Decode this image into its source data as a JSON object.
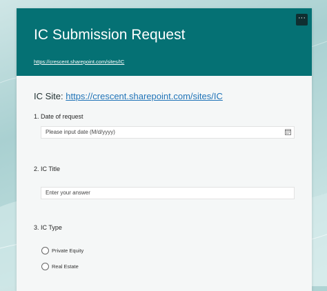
{
  "header": {
    "title": "IC Submission Request",
    "link": "https://crescent.sharepoint.com/sites/IC",
    "more_symbol": "···",
    "background": "#057174"
  },
  "site": {
    "label": "IC Site: ",
    "link": "https://crescent.sharepoint.com/sites/IC"
  },
  "questions": [
    {
      "label": "1. Date of request",
      "placeholder": "Please input date (M/d/yyyy)",
      "icon": "calendar-icon"
    },
    {
      "label": "2. IC Title",
      "placeholder": "Enter your answer"
    },
    {
      "label": "3. IC Type",
      "options": [
        "Private Equity",
        "Real Estate"
      ]
    }
  ]
}
